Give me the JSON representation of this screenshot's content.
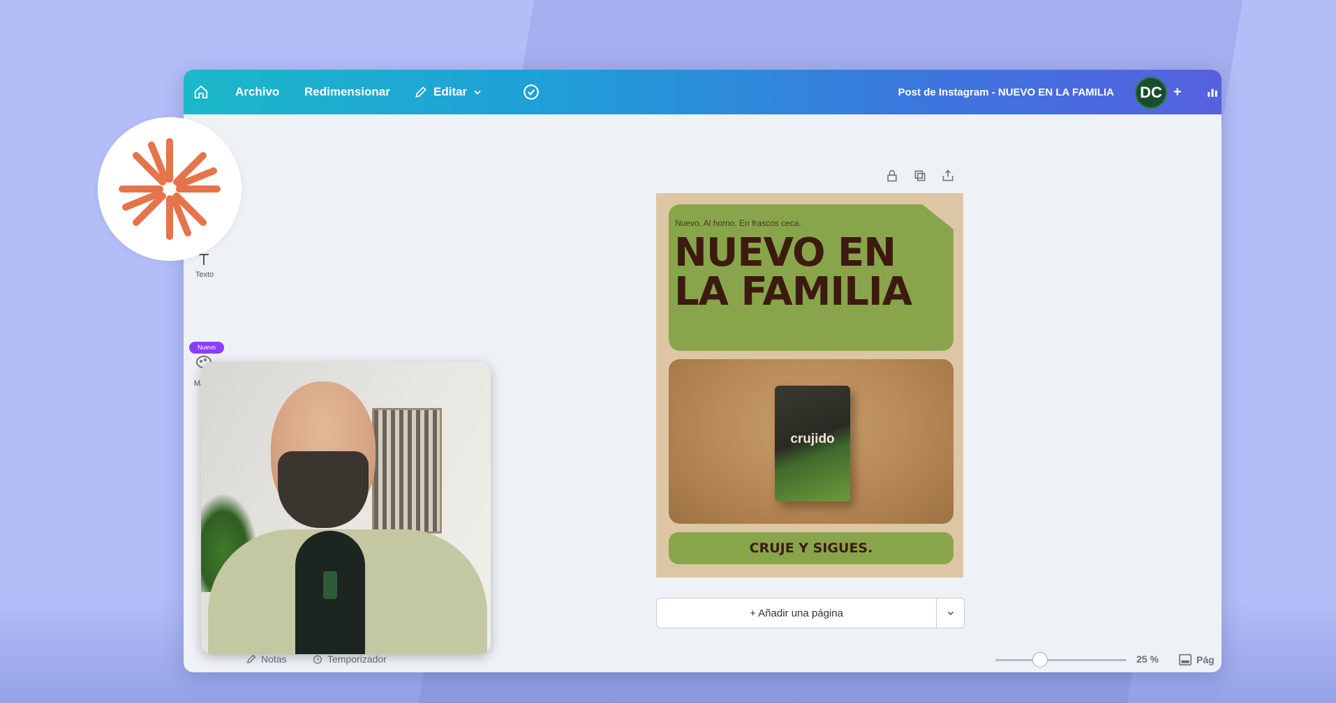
{
  "topbar": {
    "menu": {
      "file_label": "Archivo",
      "resize_label": "Redimensionar",
      "edit_label": "Editar"
    },
    "document_title": "Post de Instagram - NUEVO EN LA FAMILIA",
    "avatar_initials": "DC"
  },
  "sidebar": {
    "items": [
      {
        "label": "Texto",
        "icon": "text-icon"
      },
      {
        "label": "Marca",
        "icon": "brand-icon",
        "badge": "Nuevo"
      }
    ]
  },
  "design": {
    "tagline": "Nuevo. Al horno. En frascos ceca.",
    "headline": "NUEVO EN\nLA FAMILIA",
    "product_brand": "crujido",
    "footer_text": "CRUJE Y SIGUES.",
    "colors": {
      "background": "#dcc6a3",
      "green": "#88a54b",
      "headline": "#3d1a10"
    }
  },
  "canvas": {
    "add_page_label": "+ Añadir una página"
  },
  "bottombar": {
    "notes_label": "Notas",
    "timer_label": "Temporizador",
    "zoom_percent": "25 %",
    "pages_label": "Pág"
  },
  "theme": {
    "accent": "#1f9fd8",
    "brand_purple": "#8b3dff",
    "logo_orange": "#e5744a"
  }
}
